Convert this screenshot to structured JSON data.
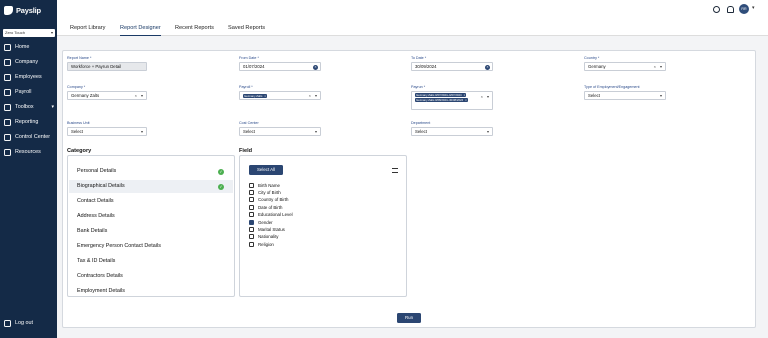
{
  "brand": {
    "name": "Payslip"
  },
  "company_select": {
    "value": "Zero Touch"
  },
  "sidebar": {
    "items": [
      {
        "label": "Home",
        "icon": "home-icon"
      },
      {
        "label": "Company",
        "icon": "building-icon"
      },
      {
        "label": "Employees",
        "icon": "users-icon"
      },
      {
        "label": "Payroll",
        "icon": "payroll-icon"
      },
      {
        "label": "Toolbox",
        "icon": "toolbox-icon"
      },
      {
        "label": "Reporting",
        "icon": "chart-icon"
      },
      {
        "label": "Control Center",
        "icon": "gear-icon"
      },
      {
        "label": "Resources",
        "icon": "list-icon"
      }
    ],
    "logout": "Log out"
  },
  "header": {
    "avatar_initials": "RR"
  },
  "tabs": [
    "Report Library",
    "Report Designer",
    "Recent Reports",
    "Saved Reports"
  ],
  "form": {
    "report_name": {
      "label": "Report Name *",
      "value": "Workforce + Payrun Detail"
    },
    "from_date": {
      "label": "From Date *",
      "value": "01/07/2024"
    },
    "to_date": {
      "label": "To Date *",
      "value": "30/09/2024"
    },
    "country": {
      "label": "Country *",
      "value": "Germany"
    },
    "company": {
      "label": "Company *",
      "value": "Germany Zalts"
    },
    "payroll": {
      "label": "Payroll *",
      "chip": "Germany Zalts"
    },
    "payrun": {
      "label": "Payrun *",
      "chips": [
        "Germany Zalts 0/07/2024–0/07/2024",
        "Germany Zalts 0/08/2024–30/08/2024"
      ]
    },
    "employment_type": {
      "label": "Type of Employment/Engagement",
      "value": "Select"
    },
    "business_unit": {
      "label": "Business Unit",
      "value": "Select"
    },
    "cost_center": {
      "label": "Cost Center",
      "value": "Select"
    },
    "department": {
      "label": "Department",
      "value": "Select"
    }
  },
  "category": {
    "title": "Category",
    "items": [
      "Personal Details",
      "Biographical Details",
      "Contact Details",
      "Address Details",
      "Bank Details",
      "Emergency Person Contact Details",
      "Tax & ID Details",
      "Contractors Details",
      "Employment Details"
    ],
    "checked_count": 2
  },
  "field": {
    "title": "Field",
    "select_all": "Select All",
    "items": [
      {
        "label": "Birth Name",
        "checked": false
      },
      {
        "label": "City of Birth",
        "checked": false
      },
      {
        "label": "Country of Birth",
        "checked": false
      },
      {
        "label": "Date of Birth",
        "checked": false
      },
      {
        "label": "Educational Level",
        "checked": false
      },
      {
        "label": "Gender",
        "checked": true
      },
      {
        "label": "Marital Status",
        "checked": false
      },
      {
        "label": "Nationality",
        "checked": false
      },
      {
        "label": "Religion",
        "checked": false
      }
    ]
  },
  "run_button": "Run",
  "colors": {
    "sidebar": "#142a47",
    "accent": "#2b4672",
    "check": "#4caf50"
  }
}
